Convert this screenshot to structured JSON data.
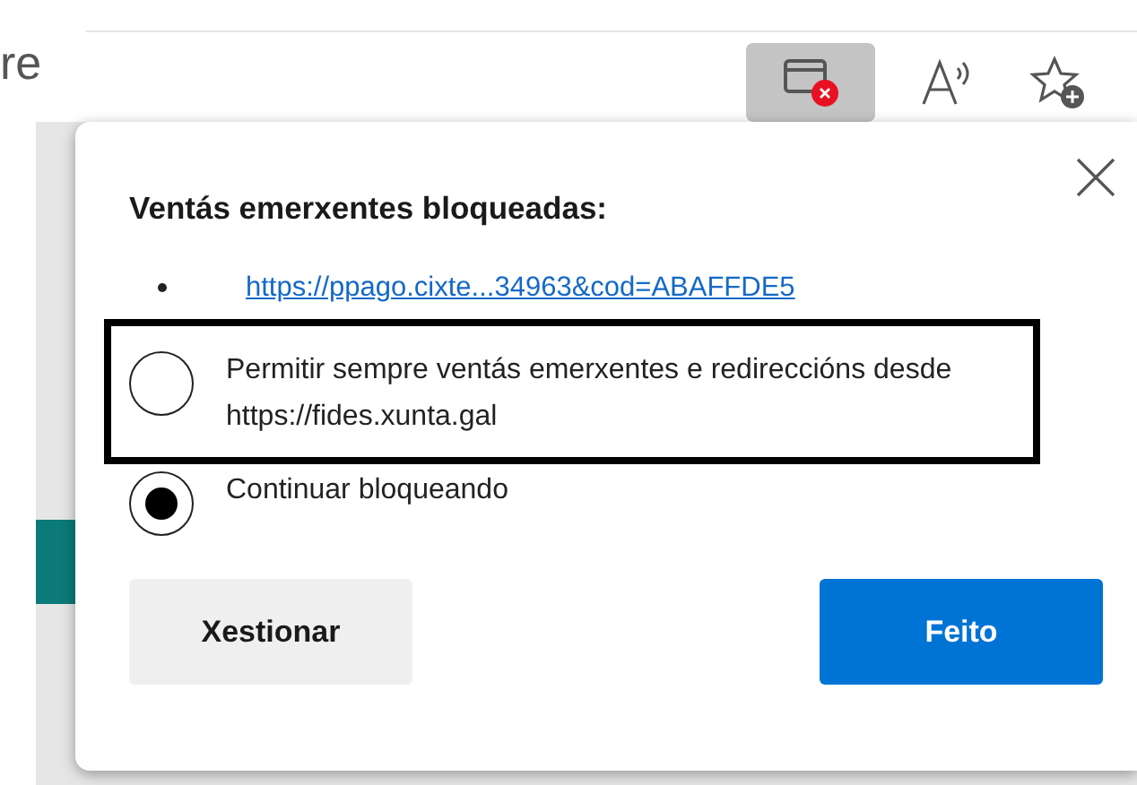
{
  "page": {
    "partial_text": "re"
  },
  "toolbar": {
    "buttons": [
      {
        "kind": "popup-blocked",
        "selected": true
      },
      {
        "kind": "read-aloud",
        "selected": false
      },
      {
        "kind": "favorite",
        "selected": false
      }
    ]
  },
  "popup": {
    "title": "Ventás emerxentes bloqueadas:",
    "blocked_links": [
      "https://ppago.cixte...34963&cod=ABAFFDE5"
    ],
    "options": [
      {
        "label": "Permitir sempre ventás emerxentes e redireccións desde https://fides.xunta.gal",
        "selected": false,
        "highlighted": true
      },
      {
        "label": "Continuar bloqueando",
        "selected": true,
        "highlighted": false
      }
    ],
    "buttons": [
      {
        "label": "Xestionar",
        "kind": "secondary"
      },
      {
        "label": "Feito",
        "kind": "primary"
      }
    ]
  }
}
